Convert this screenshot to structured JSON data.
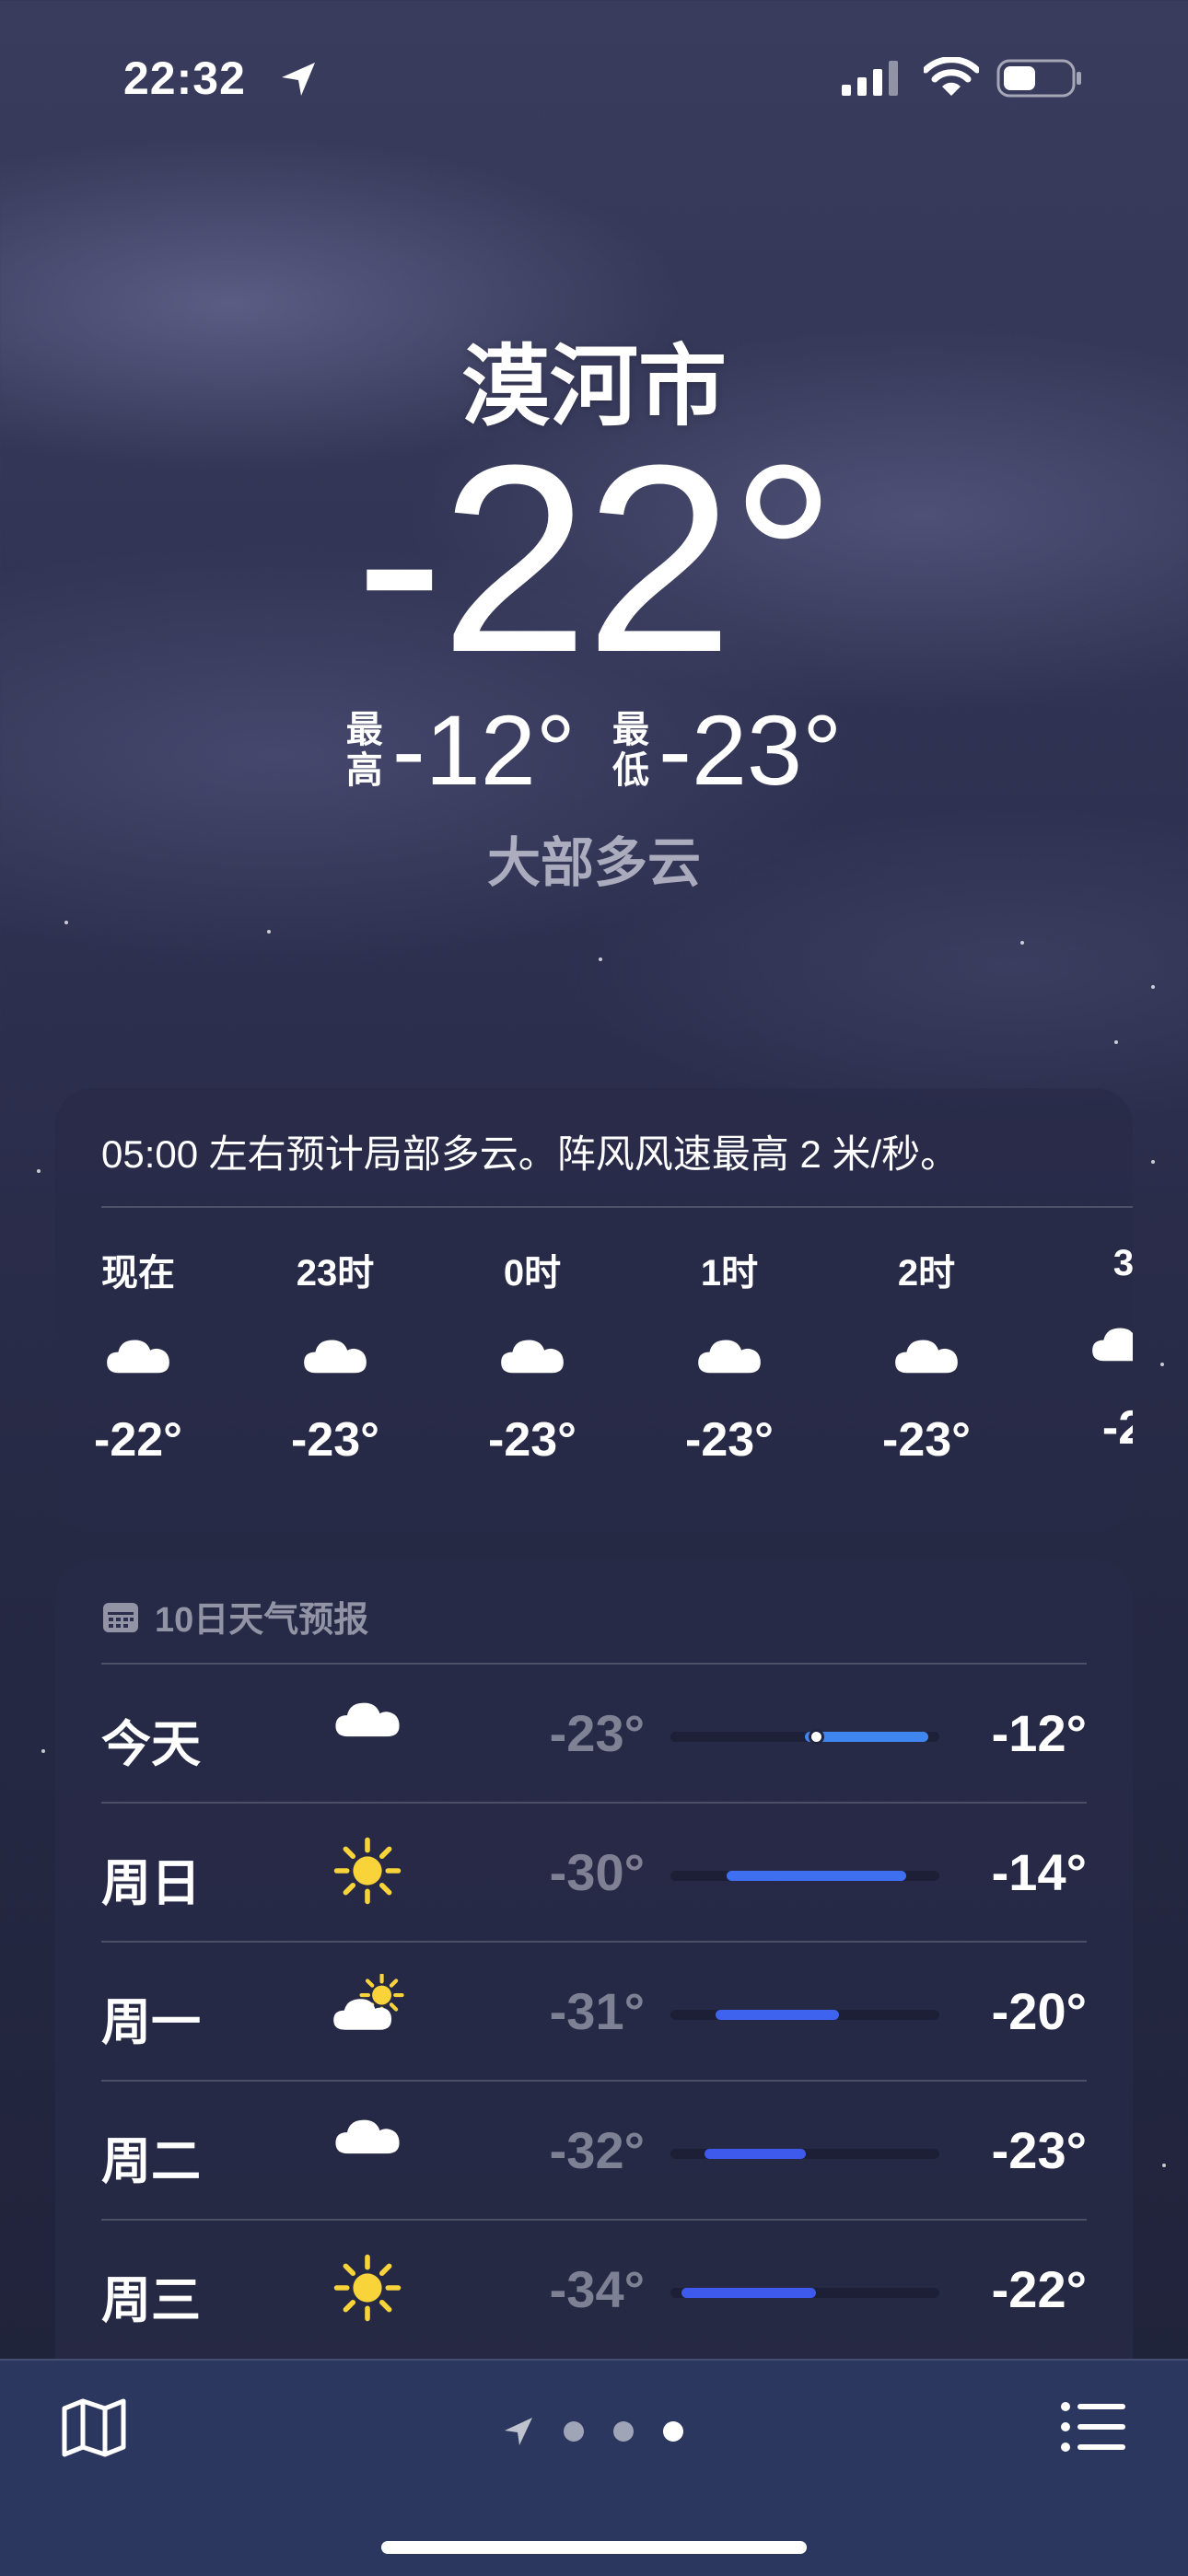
{
  "status": {
    "time": "22:32"
  },
  "header": {
    "city": "漠河市",
    "temp": "-22°",
    "high_label": [
      "最",
      "高"
    ],
    "high": "-12°",
    "low_label": [
      "最",
      "低"
    ],
    "low": "-23°",
    "condition": "大部多云"
  },
  "hourly": {
    "description": "05:00 左右预计局部多云。阵风风速最高 2 米/秒。",
    "items": [
      {
        "label": "现在",
        "icon": "cloud-icon",
        "temp": "-22°"
      },
      {
        "label": "23时",
        "icon": "cloud-icon",
        "temp": "-23°"
      },
      {
        "label": "0时",
        "icon": "cloud-icon",
        "temp": "-23°"
      },
      {
        "label": "1时",
        "icon": "cloud-icon",
        "temp": "-23°"
      },
      {
        "label": "2时",
        "icon": "cloud-icon",
        "temp": "-23°"
      },
      {
        "label": "3",
        "icon": "cloud-icon",
        "temp": "-2"
      }
    ]
  },
  "daily": {
    "title": "10日天气预报",
    "range_min": -35,
    "range_max": -11,
    "current_temp": -22,
    "rows": [
      {
        "day": "今天",
        "icon": "cloud-icon",
        "low": "-23°",
        "high": "-12°",
        "low_val": -23,
        "high_val": -12,
        "bar_color": "#3f86f0"
      },
      {
        "day": "周日",
        "icon": "sun-icon",
        "low": "-30°",
        "high": "-14°",
        "low_val": -30,
        "high_val": -14,
        "bar_color": "#3e6ff0"
      },
      {
        "day": "周一",
        "icon": "partly-cloudy-icon",
        "low": "-31°",
        "high": "-20°",
        "low_val": -31,
        "high_val": -20,
        "bar_color": "#3e63ee"
      },
      {
        "day": "周二",
        "icon": "cloud-icon",
        "low": "-32°",
        "high": "-23°",
        "low_val": -32,
        "high_val": -23,
        "bar_color": "#3e5aec"
      },
      {
        "day": "周三",
        "icon": "sun-icon",
        "low": "-34°",
        "high": "-22°",
        "low_val": -34,
        "high_val": -22,
        "bar_color": "#3e5aec"
      }
    ]
  },
  "bottom_bar": {
    "page_count": 3,
    "active_page": 3
  }
}
